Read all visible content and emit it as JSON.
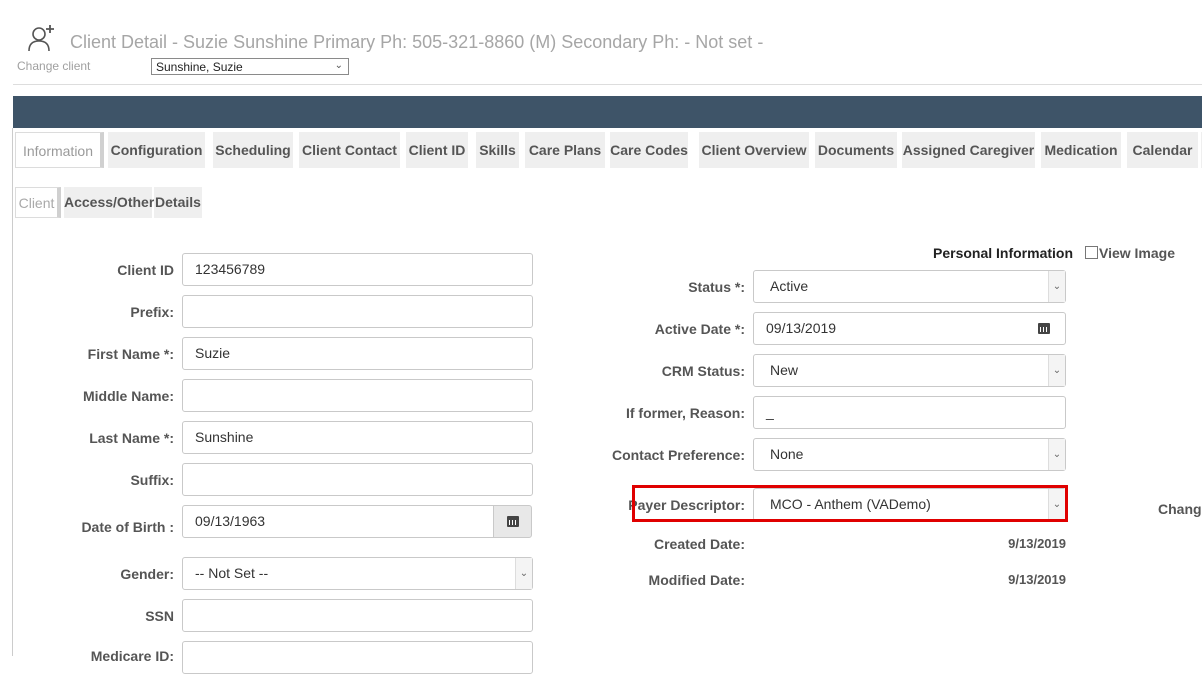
{
  "header": {
    "title": "Client Detail - Suzie Sunshine Primary Ph: 505-321-8860 (M) Secondary Ph: - Not set -",
    "change_client_label": "Change client",
    "client_select_value": "Sunshine, Suzie",
    "icon": "user-add-icon"
  },
  "tabs": [
    "Information",
    "Configuration",
    "Scheduling",
    "Client Contact",
    "Client ID",
    "Skills",
    "Care Plans",
    "Care Codes",
    "Client Overview",
    "Documents",
    "Assigned Caregiver",
    "Medication",
    "Calendar"
  ],
  "subtabs": [
    "Client",
    "Access/Other",
    "Details"
  ],
  "left_form": {
    "client_id": {
      "label": "Client ID",
      "value": "123456789"
    },
    "prefix": {
      "label": "Prefix:",
      "value": ""
    },
    "first_name": {
      "label": "First Name *:",
      "value": "Suzie"
    },
    "middle_name": {
      "label": "Middle Name:",
      "value": ""
    },
    "last_name": {
      "label": "Last Name *:",
      "value": "Sunshine"
    },
    "suffix": {
      "label": "Suffix:",
      "value": ""
    },
    "dob": {
      "label": "Date of Birth :",
      "value": "09/13/1963"
    },
    "gender": {
      "label": "Gender:",
      "value": "-- Not Set --"
    },
    "ssn": {
      "label": "SSN",
      "value": ""
    },
    "medicare": {
      "label": "Medicare ID:",
      "value": ""
    }
  },
  "right_form": {
    "section_title": "Personal Information",
    "view_image": "View Image",
    "status": {
      "label": "Status *:",
      "value": "Active"
    },
    "active_date": {
      "label": "Active Date *:",
      "value": "09/13/2019"
    },
    "crm_status": {
      "label": "CRM Status:",
      "value": "New"
    },
    "former_reason": {
      "label": "If former, Reason:",
      "value": "_"
    },
    "contact_pref": {
      "label": "Contact Preference:",
      "value": "None"
    },
    "payer_descriptor": {
      "label": "Payer Descriptor:",
      "value": "MCO - Anthem (VADemo)"
    },
    "created_date": {
      "label": "Created Date:",
      "value": "9/13/2019"
    },
    "modified_date": {
      "label": "Modified Date:",
      "value": "9/13/2019"
    },
    "change_label": "Change"
  },
  "colors": {
    "nav_bar": "#3e5468",
    "highlight": "#e00000"
  }
}
